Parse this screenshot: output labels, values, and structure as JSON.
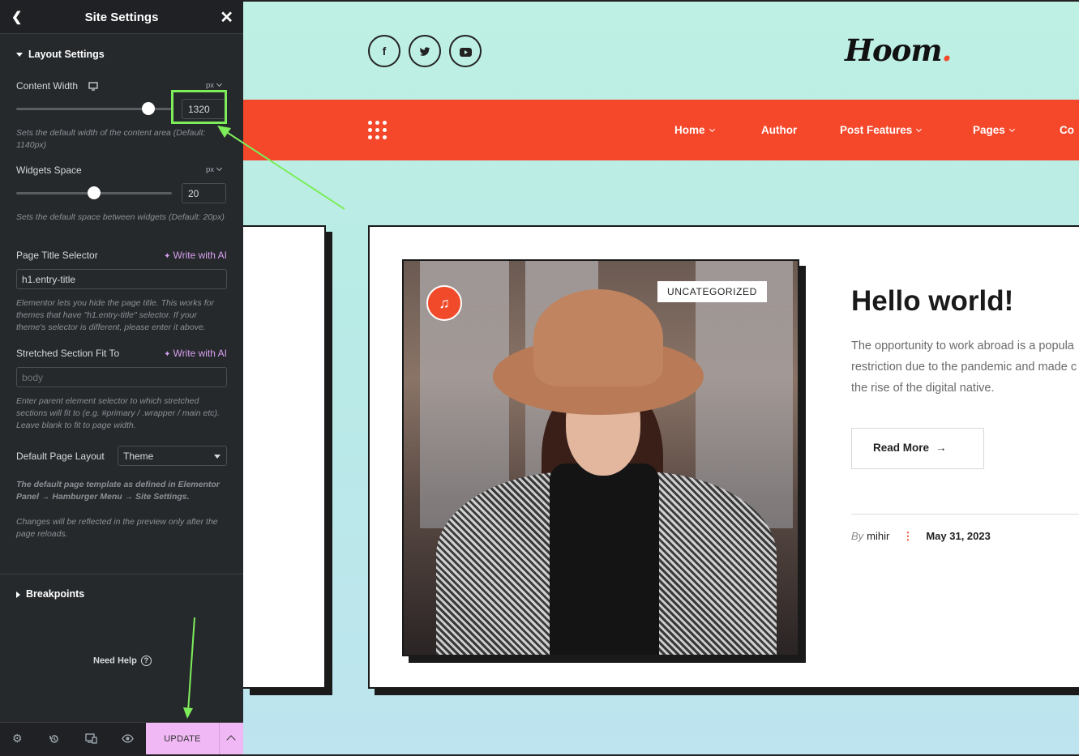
{
  "panel": {
    "title": "Site Settings",
    "back_icon": "chevron-left-icon",
    "close_icon": "close-icon",
    "layout_section": "Layout Settings",
    "content_width": {
      "label": "Content Width",
      "unit": "px",
      "value": "1320",
      "help": "Sets the default width of the content area (Default: 1140px)",
      "device_icon": "desktop-icon",
      "level_fraction": 0.85
    },
    "widgets_space": {
      "label": "Widgets Space",
      "unit": "px",
      "value": "20",
      "help": "Sets the default space between widgets (Default: 20px)",
      "level_fraction": 0.5
    },
    "page_title_selector": {
      "label": "Page Title Selector",
      "ai_label": "Write with AI",
      "value": "h1.entry-title",
      "help": "Elementor lets you hide the page title. This works for themes that have \"h1.entry-title\" selector. If your theme's selector is different, please enter it above."
    },
    "stretched_section": {
      "label": "Stretched Section Fit To",
      "ai_label": "Write with AI",
      "placeholder": "body",
      "help": "Enter parent element selector to which stretched sections will fit to (e.g. #primary / .wrapper / main etc). Leave blank to fit to page width."
    },
    "default_page_layout": {
      "label": "Default Page Layout",
      "value": "Theme",
      "help": "The default page template as defined in Elementor Panel → Hamburger Menu → Site Settings.",
      "note": "Changes will be reflected in the preview only after the page reloads."
    },
    "breakpoints_section": "Breakpoints",
    "need_help": "Need Help",
    "footer": {
      "update_label": "UPDATE",
      "icons": [
        "settings-icon",
        "history-icon",
        "responsive-icon",
        "preview-icon"
      ]
    }
  },
  "site": {
    "logo": "Hoom",
    "logo_dot": ".",
    "social": [
      {
        "icon": "facebook-icon",
        "glyph": "f"
      },
      {
        "icon": "twitter-icon",
        "glyph": "t"
      },
      {
        "icon": "youtube-icon",
        "glyph": "▶"
      }
    ],
    "nav": [
      "Home",
      "Author",
      "Post Features",
      "Pages",
      "Co"
    ],
    "post": {
      "category": "UNCATEGORIZED",
      "title": "Hello world!",
      "excerpt_lines": [
        "The opportunity to work abroad is a popula",
        "restriction due to the pandemic and made c",
        "the rise of the digital native."
      ],
      "read_more": "Read More",
      "by": "By",
      "author": "mihir",
      "date": "May 31, 2023"
    }
  },
  "colors": {
    "panel_bg": "#26292c",
    "nav_bg": "#f5472a",
    "update_bg": "#f0b8f5",
    "ai_accent": "#d8a0f0",
    "highlight": "#7ded5a"
  }
}
